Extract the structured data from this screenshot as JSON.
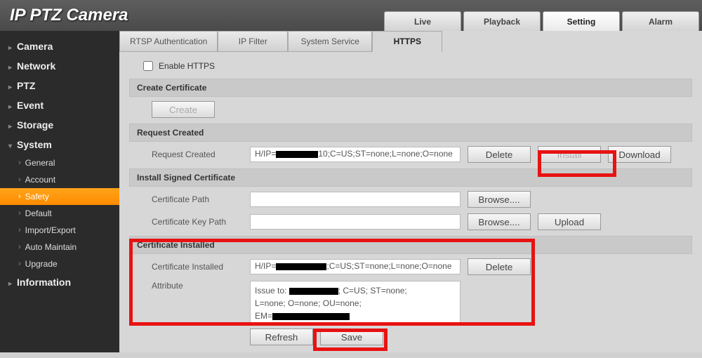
{
  "app_title": "IP PTZ Camera",
  "top_tabs": [
    "Live",
    "Playback",
    "Setting",
    "Alarm"
  ],
  "top_tab_active": 2,
  "nav": [
    {
      "label": "Camera",
      "type": "top"
    },
    {
      "label": "Network",
      "type": "top"
    },
    {
      "label": "PTZ",
      "type": "top"
    },
    {
      "label": "Event",
      "type": "top"
    },
    {
      "label": "Storage",
      "type": "top"
    },
    {
      "label": "System",
      "type": "top",
      "open": true,
      "subs": [
        {
          "label": "General"
        },
        {
          "label": "Account"
        },
        {
          "label": "Safety",
          "active": true
        },
        {
          "label": "Default"
        },
        {
          "label": "Import/Export"
        },
        {
          "label": "Auto Maintain"
        },
        {
          "label": "Upgrade"
        }
      ]
    },
    {
      "label": "Information",
      "type": "top"
    }
  ],
  "sub_tabs": [
    "RTSP Authentication",
    "IP Filter",
    "System Service",
    "HTTPS"
  ],
  "sub_tab_active": 3,
  "https": {
    "enable_label": "Enable HTTPS",
    "sections": {
      "create_cert": "Create Certificate",
      "request_created": "Request Created",
      "install_signed": "Install Signed Certificate",
      "cert_installed": "Certificate Installed"
    },
    "fields": {
      "request_created_label": "Request Created",
      "request_created_value_prefix": "H/IP=",
      "request_created_value_suffix": "10;C=US;ST=none;L=none;O=none",
      "cert_path_label": "Certificate Path",
      "cert_key_path_label": "Certificate Key Path",
      "cert_installed_label": "Certificate Installed",
      "cert_installed_value_prefix": "H/IP=",
      "cert_installed_value_suffix": ";C=US;ST=none;L=none;O=none",
      "attribute_label": "Attribute",
      "attribute_line1_prefix": "Issue to: ",
      "attribute_line1_suffix": "; C=US; ST=none;",
      "attribute_line2": "L=none; O=none; OU=none;",
      "attribute_line3": "EM="
    },
    "buttons": {
      "create": "Create",
      "delete": "Delete",
      "install": "Install",
      "download": "Download",
      "browse": "Browse....",
      "upload": "Upload",
      "refresh": "Refresh",
      "save": "Save"
    }
  }
}
